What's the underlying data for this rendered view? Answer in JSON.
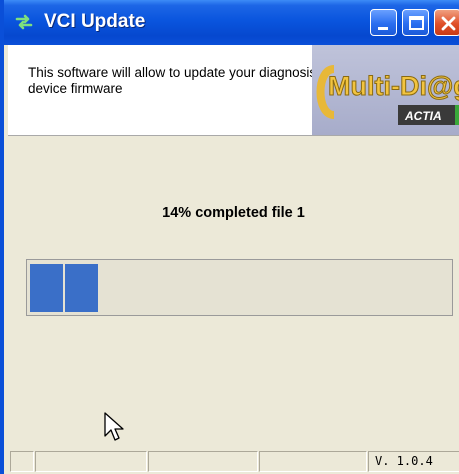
{
  "window": {
    "title": "VCI Update",
    "controls": {
      "minimize": "minimize",
      "maximize": "maximize",
      "close": "close"
    }
  },
  "header": {
    "description": "This software will allow to update your diagnosis device firmware",
    "logo": {
      "text": "Multi-Di@g",
      "brand": "ACTIA"
    }
  },
  "progress": {
    "status_text": "14% completed file 1",
    "percent": 14,
    "segments_filled": 2
  },
  "statusbar": {
    "version": "V. 1.0.4"
  },
  "colors": {
    "titlebar": "#0a55de",
    "progress_fill": "#3a6fc8",
    "background": "#ece9d8",
    "logo_gold": "#e8b838"
  }
}
